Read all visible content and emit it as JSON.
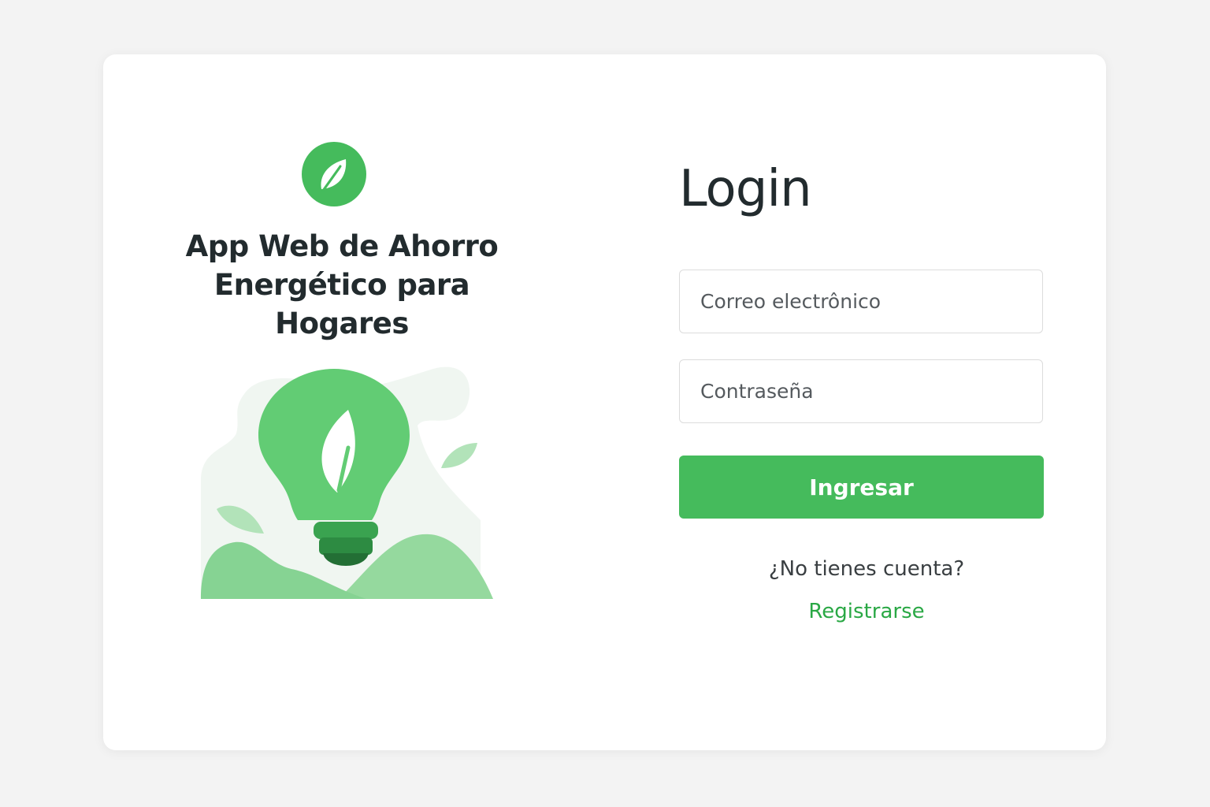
{
  "brand": {
    "logo_icon": "leaf-icon",
    "title_line1": "App Web de Ahorro",
    "title_line2": "Energético para Hogares",
    "accent_color": "#45bb5c"
  },
  "illustration": {
    "icon": "lightbulb-leaf-icon"
  },
  "login": {
    "title": "Login",
    "email_placeholder": "Correo electrônico",
    "password_placeholder": "Contraseña",
    "submit_label": "Ingresar",
    "no_account_text": "¿No tienes cuenta?",
    "register_label": "Registrarse"
  }
}
